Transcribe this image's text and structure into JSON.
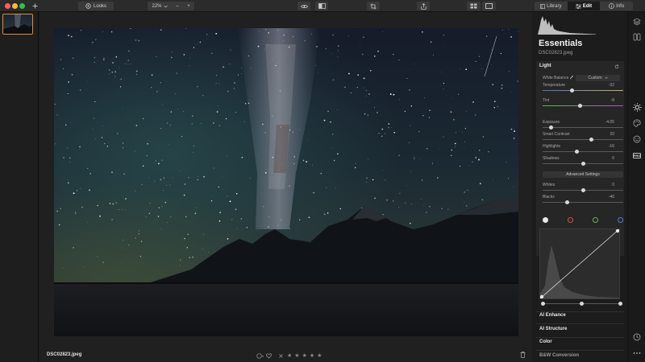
{
  "toolbar": {
    "looks_label": "Looks",
    "zoom_value": "22%",
    "zoom_minus": "–",
    "zoom_plus": "+",
    "tabs": [
      {
        "label": "Library"
      },
      {
        "label": "Edit"
      },
      {
        "label": "Info"
      }
    ],
    "active_tab": "Edit"
  },
  "canvas": {
    "filename": "DSC02823.jpeg"
  },
  "panel": {
    "title": "Essentials",
    "file": "DSC02823.jpeg",
    "light": {
      "header": "Light",
      "white_balance_label": "White Balance",
      "white_balance_value": "Custom",
      "rows": [
        {
          "label": "Temperature",
          "value": "-32",
          "pos": 0.36
        },
        {
          "label": "Tint",
          "value": "-8",
          "pos": 0.46
        },
        {
          "label": "Exposure",
          "value": "-4.05",
          "pos": 0.1
        },
        {
          "label": "Smart Contrast",
          "value": "20",
          "pos": 0.6
        },
        {
          "label": "Highlights",
          "value": "-16",
          "pos": 0.42
        },
        {
          "label": "Shadows",
          "value": "0",
          "pos": 0.5
        },
        {
          "label": "Whites",
          "value": "0",
          "pos": 0.5
        },
        {
          "label": "Blacks",
          "value": "-40",
          "pos": 0.3
        }
      ],
      "advanced_settings": "Advanced Settings"
    },
    "sections": [
      {
        "label": "AI Enhance"
      },
      {
        "label": "AI Structure"
      },
      {
        "label": "Color"
      },
      {
        "label": "B&W Conversion"
      }
    ]
  },
  "colors": {
    "accent_orange": "#e38d2a",
    "curve_white": "#e8e8e8",
    "curve_red": "#d9534f",
    "curve_green": "#5cb85c",
    "curve_blue": "#4a7fd6"
  }
}
